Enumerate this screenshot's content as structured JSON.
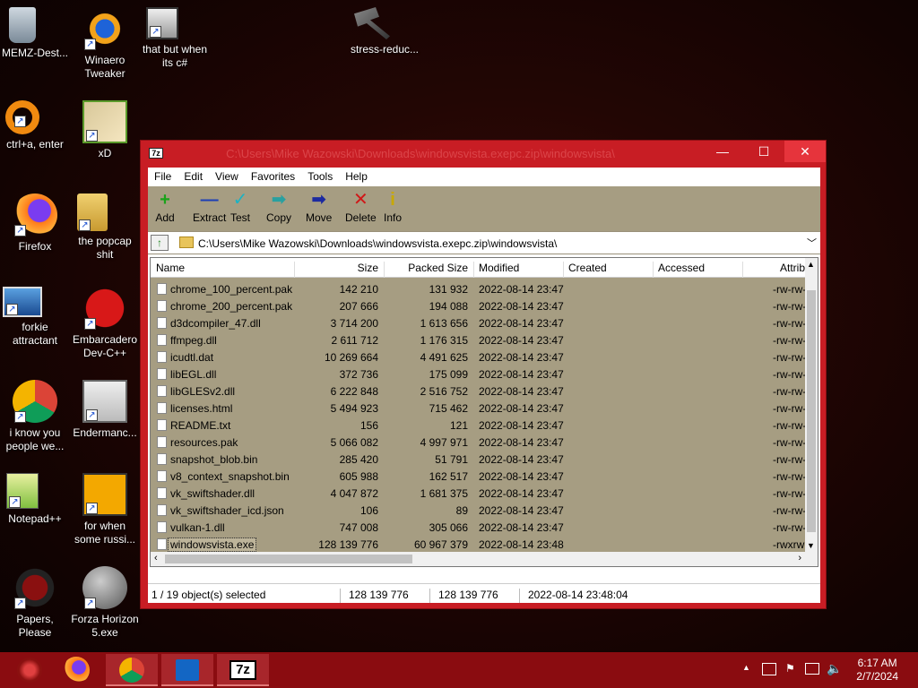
{
  "desktop": {
    "icons": [
      {
        "label": "MEMZ-Dest...",
        "icon": "recycle-bin-icon"
      },
      {
        "label": "Winaero Tweaker",
        "icon": "winaero-icon"
      },
      {
        "label": "that but when its c#",
        "icon": "windows-stack-icon"
      },
      {
        "label": "stress-reduc...",
        "icon": "hammer-icon"
      },
      {
        "label": "ctrl+a, enter",
        "icon": "orange-ring-icon"
      },
      {
        "label": "xD",
        "icon": "hxd-icon"
      },
      {
        "label": "Firefox",
        "icon": "firefox-icon"
      },
      {
        "label": "the popcap shit",
        "icon": "popcap-folder-icon"
      },
      {
        "label": "forkie attractant",
        "icon": "computer-gear-icon"
      },
      {
        "label": "Embarcadero Dev-C++",
        "icon": "devcpp-icon"
      },
      {
        "label": "i know you people we...",
        "icon": "chrome-icon"
      },
      {
        "label": "Endermanc...",
        "icon": "endermanch-icon"
      },
      {
        "label": "Notepad++",
        "icon": "notepadpp-icon"
      },
      {
        "label": "for when some russi...",
        "icon": "de-icon"
      },
      {
        "label": "Papers, Please",
        "icon": "papers-please-icon"
      },
      {
        "label": "Forza Horizon 5.exe",
        "icon": "flash-icon"
      }
    ]
  },
  "window": {
    "app_icon": "7z",
    "title": "C:\\Users\\Mike Wazowski\\Downloads\\windowsvista.exepc.zip\\windowsvista\\",
    "minimize": "—",
    "maximize": "☐",
    "close": "✕",
    "menu": [
      "File",
      "Edit",
      "View",
      "Favorites",
      "Tools",
      "Help"
    ],
    "toolbar": [
      {
        "label": "Add",
        "glyph": "+",
        "color": "#1aa31a"
      },
      {
        "label": "Extract",
        "glyph": "—",
        "color": "#1c3fb5"
      },
      {
        "label": "Test",
        "glyph": "✓",
        "color": "#1bb3c4"
      },
      {
        "label": "Copy",
        "glyph": "➡",
        "color": "#2aa0a0"
      },
      {
        "label": "Move",
        "glyph": "➡",
        "color": "#1c2aa0"
      },
      {
        "label": "Delete",
        "glyph": "✕",
        "color": "#d01818"
      },
      {
        "label": "Info",
        "glyph": "i",
        "color": "#c8a800"
      }
    ],
    "address": "C:\\Users\\Mike Wazowski\\Downloads\\windowsvista.exepc.zip\\windowsvista\\",
    "columns": [
      "Name",
      "Size",
      "Packed Size",
      "Modified",
      "Created",
      "Accessed",
      "Attrib"
    ],
    "files": [
      {
        "name": "chrome_100_percent.pak",
        "size": "142 210",
        "packed": "131 932",
        "modified": "2022-08-14 23:47",
        "attrib": "-rw-rw-"
      },
      {
        "name": "chrome_200_percent.pak",
        "size": "207 666",
        "packed": "194 088",
        "modified": "2022-08-14 23:47",
        "attrib": "-rw-rw-"
      },
      {
        "name": "d3dcompiler_47.dll",
        "size": "3 714 200",
        "packed": "1 613 656",
        "modified": "2022-08-14 23:47",
        "attrib": "-rw-rw-"
      },
      {
        "name": "ffmpeg.dll",
        "size": "2 611 712",
        "packed": "1 176 315",
        "modified": "2022-08-14 23:47",
        "attrib": "-rw-rw-"
      },
      {
        "name": "icudtl.dat",
        "size": "10 269 664",
        "packed": "4 491 625",
        "modified": "2022-08-14 23:47",
        "attrib": "-rw-rw-"
      },
      {
        "name": "libEGL.dll",
        "size": "372 736",
        "packed": "175 099",
        "modified": "2022-08-14 23:47",
        "attrib": "-rw-rw-"
      },
      {
        "name": "libGLESv2.dll",
        "size": "6 222 848",
        "packed": "2 516 752",
        "modified": "2022-08-14 23:47",
        "attrib": "-rw-rw-"
      },
      {
        "name": "licenses.html",
        "size": "5 494 923",
        "packed": "715 462",
        "modified": "2022-08-14 23:47",
        "attrib": "-rw-rw-"
      },
      {
        "name": "README.txt",
        "size": "156",
        "packed": "121",
        "modified": "2022-08-14 23:47",
        "attrib": "-rw-rw-"
      },
      {
        "name": "resources.pak",
        "size": "5 066 082",
        "packed": "4 997 971",
        "modified": "2022-08-14 23:47",
        "attrib": "-rw-rw-"
      },
      {
        "name": "snapshot_blob.bin",
        "size": "285 420",
        "packed": "51 791",
        "modified": "2022-08-14 23:47",
        "attrib": "-rw-rw-"
      },
      {
        "name": "v8_context_snapshot.bin",
        "size": "605 988",
        "packed": "162 517",
        "modified": "2022-08-14 23:47",
        "attrib": "-rw-rw-"
      },
      {
        "name": "vk_swiftshader.dll",
        "size": "4 047 872",
        "packed": "1 681 375",
        "modified": "2022-08-14 23:47",
        "attrib": "-rw-rw-"
      },
      {
        "name": "vk_swiftshader_icd.json",
        "size": "106",
        "packed": "89",
        "modified": "2022-08-14 23:47",
        "attrib": "-rw-rw-"
      },
      {
        "name": "vulkan-1.dll",
        "size": "747 008",
        "packed": "305 066",
        "modified": "2022-08-14 23:47",
        "attrib": "-rw-rw-"
      },
      {
        "name": "windowsvista.exe",
        "size": "128 139 776",
        "packed": "60 967 379",
        "modified": "2022-08-14 23:48",
        "attrib": "-rwxrw",
        "selected": true
      }
    ],
    "status": {
      "selection": "1 / 19 object(s) selected",
      "size": "128 139 776",
      "packed": "128 139 776",
      "modified": "2022-08-14 23:48:04"
    }
  },
  "taskbar": {
    "items": [
      {
        "name": "start-orb",
        "icon": "start-orb-icon"
      },
      {
        "name": "firefox",
        "icon": "firefox-icon"
      },
      {
        "name": "chrome",
        "icon": "chrome-icon"
      },
      {
        "name": "outlook",
        "icon": "outlook-icon"
      },
      {
        "name": "7zip",
        "icon": "7zip-icon",
        "label": "7z"
      }
    ],
    "tray_up": "▲",
    "clock_time": "6:17 AM",
    "clock_date": "2/7/2024"
  }
}
